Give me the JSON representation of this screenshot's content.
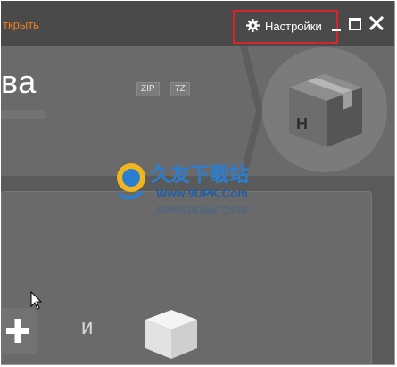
{
  "header": {
    "open_label": "ткрыть",
    "settings_label": "Настройки"
  },
  "hero": {
    "title": "ва",
    "formats": [
      "ZIP",
      "7Z"
    ],
    "box_letter": "H"
  },
  "watermark": {
    "cn_text": "久友下载站",
    "url": "Www.9UPK.Com"
  },
  "drop_area": {
    "and_label": "и"
  },
  "colors": {
    "accent": "#f07f1b",
    "highlight_border": "#d9242b",
    "background": "#5a5a5a"
  }
}
